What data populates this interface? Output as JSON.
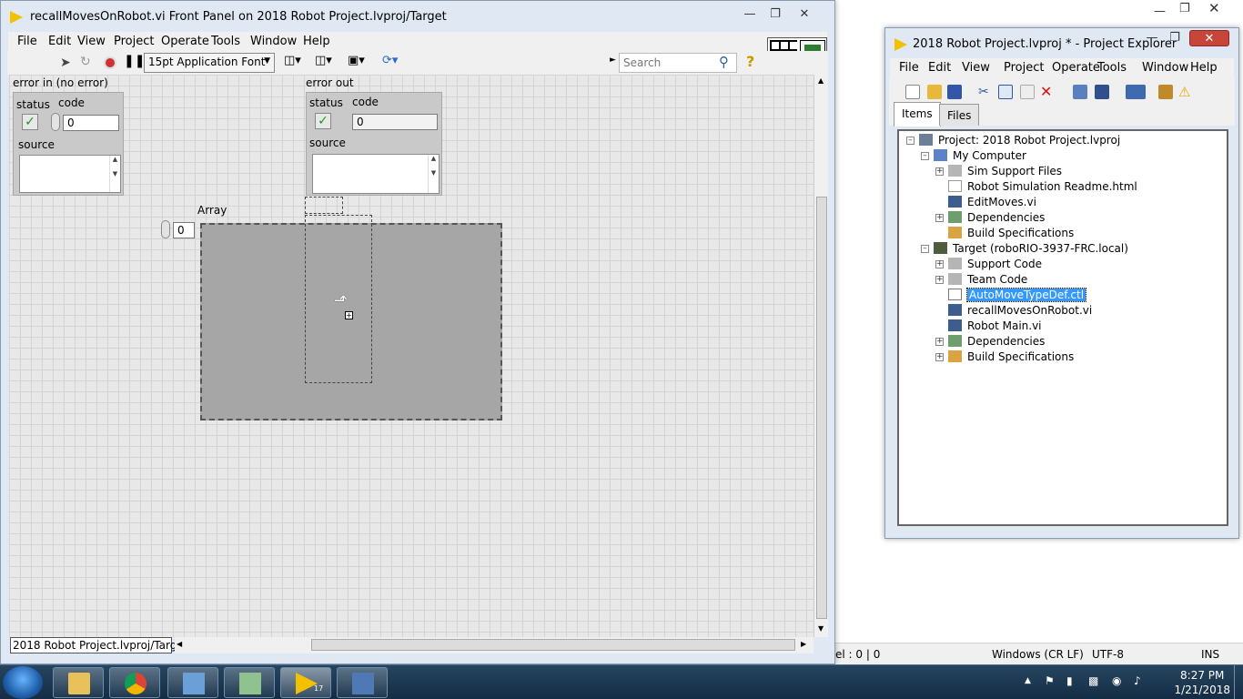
{
  "background_window": {
    "status": {
      "position": "el : 0 | 0",
      "line_ending": "Windows (CR LF)",
      "encoding": "UTF-8",
      "mode": "INS"
    }
  },
  "front_panel": {
    "title": "recallMovesOnRobot.vi Front Panel on 2018 Robot Project.lvproj/Target",
    "menu": [
      "File",
      "Edit",
      "View",
      "Project",
      "Operate",
      "Tools",
      "Window",
      "Help"
    ],
    "toolbar": {
      "font": "15pt Application Font",
      "search_placeholder": "Search",
      "help": "?"
    },
    "error_in": {
      "label": "error in (no error)",
      "status_label": "status",
      "code_label": "code",
      "code": "0",
      "source_label": "source"
    },
    "error_out": {
      "label": "error out",
      "status_label": "status",
      "code_label": "code",
      "code": "0",
      "source_label": "source"
    },
    "array": {
      "label": "Array",
      "index": "0"
    },
    "path": "2018 Robot Project.lvproj/Target",
    "connector_badge": "2"
  },
  "project_explorer": {
    "title": "2018 Robot Project.lvproj * - Project Explorer",
    "menu": [
      "File",
      "Edit",
      "View",
      "Project",
      "Operate",
      "Tools",
      "Window",
      "Help"
    ],
    "tabs": [
      "Items",
      "Files"
    ],
    "tree": [
      {
        "label": "Project: 2018 Robot Project.lvproj"
      },
      {
        "label": "My Computer"
      },
      {
        "label": "Sim Support Files"
      },
      {
        "label": "Robot Simulation Readme.html"
      },
      {
        "label": "EditMoves.vi"
      },
      {
        "label": "Dependencies"
      },
      {
        "label": "Build Specifications"
      },
      {
        "label": "Target (roboRIO-3937-FRC.local)"
      },
      {
        "label": "Support Code"
      },
      {
        "label": "Team Code"
      },
      {
        "label": "AutoMoveTypeDef.ctl"
      },
      {
        "label": "recallMovesOnRobot.vi"
      },
      {
        "label": "Robot Main.vi"
      },
      {
        "label": "Dependencies"
      },
      {
        "label": "Build Specifications"
      }
    ]
  },
  "taskbar": {
    "time": "8:27 PM",
    "date": "1/21/2018",
    "lv_badge": "17"
  }
}
